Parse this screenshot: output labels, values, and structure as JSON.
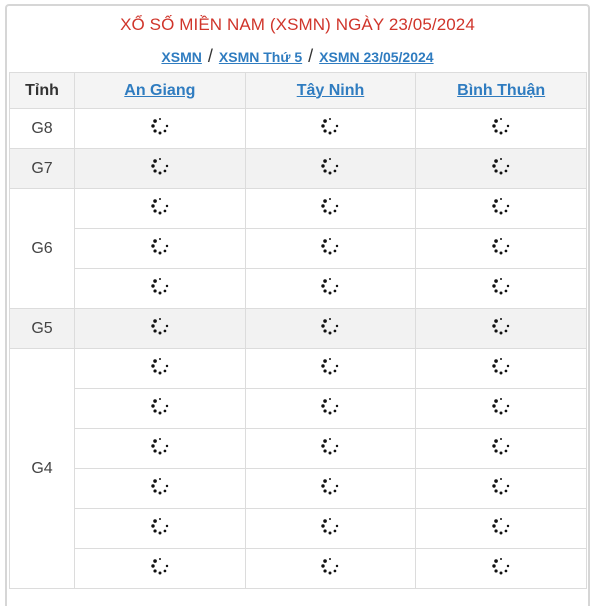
{
  "header": {
    "title": "XỔ SỐ MIỀN NAM (XSMN) NGÀY 23/05/2024",
    "breadcrumbs": [
      "XSMN",
      "XSMN Thứ 5",
      "XSMN 23/05/2024"
    ],
    "separator": "/"
  },
  "table": {
    "corner_label": "Tỉnh",
    "provinces": [
      "An Giang",
      "Tây Ninh",
      "Bình Thuận"
    ],
    "prizes": [
      {
        "label": "G8",
        "rows": 1
      },
      {
        "label": "G7",
        "rows": 1
      },
      {
        "label": "G6",
        "rows": 3
      },
      {
        "label": "G5",
        "rows": 1
      },
      {
        "label": "G4",
        "rows": 6
      }
    ],
    "cell_icon": "loading-spinner-icon"
  }
}
